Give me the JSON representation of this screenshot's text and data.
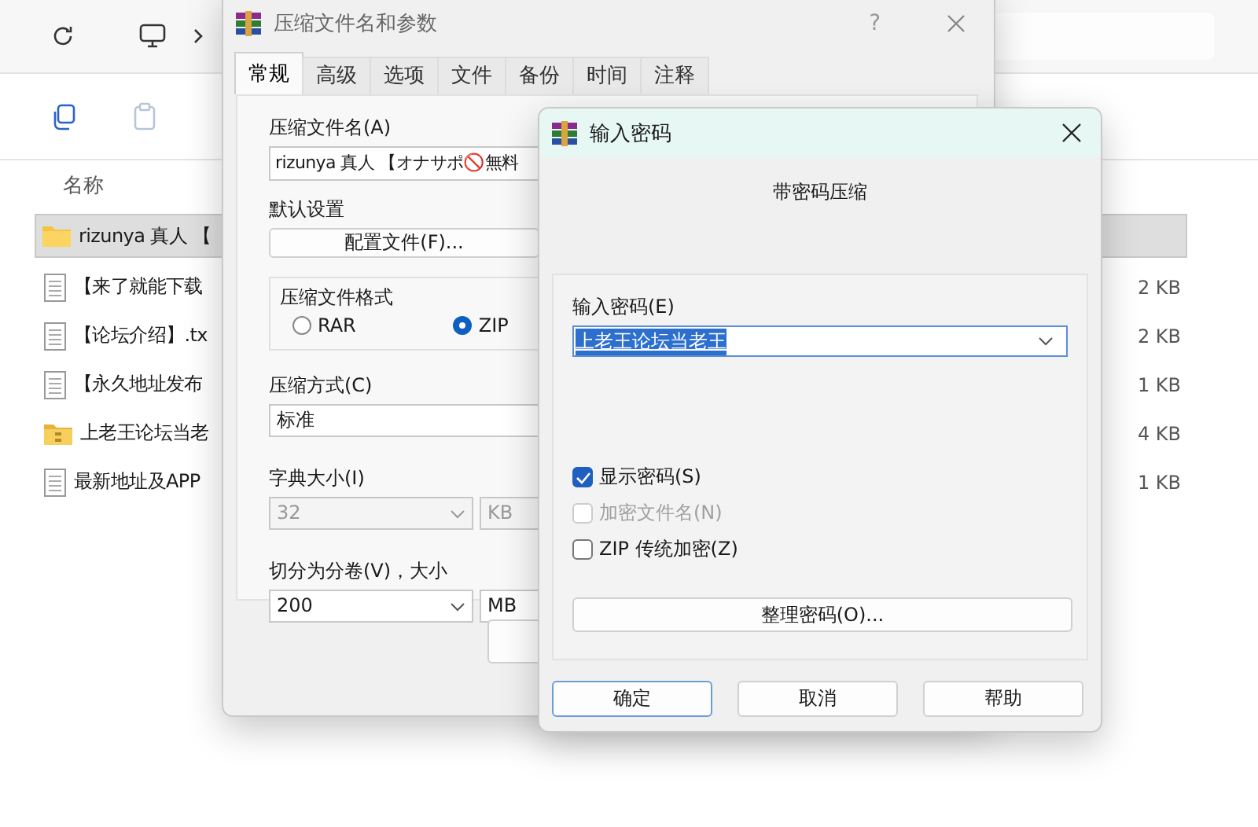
{
  "explorer": {
    "column_header": "名称",
    "files": [
      {
        "name": "rizunya 真人 【",
        "kind": "folder",
        "selected": true
      },
      {
        "name": "【来了就能下载",
        "kind": "text",
        "size": "2 KB",
        "selected": false
      },
      {
        "name": "【论坛介绍】.tx",
        "kind": "text",
        "size": "2 KB",
        "selected": false
      },
      {
        "name": "【永久地址发布",
        "kind": "text",
        "size": "1 KB",
        "selected": false
      },
      {
        "name": "上老王论坛当老",
        "kind": "archive",
        "size": "4 KB",
        "selected": false
      },
      {
        "name": "最新地址及APP",
        "kind": "text",
        "size": "1 KB",
        "selected": false
      }
    ]
  },
  "archive_dialog": {
    "title": "压缩文件名和参数",
    "help": "?",
    "tabs": [
      {
        "label": "常规",
        "selected": true
      },
      {
        "label": "高级",
        "selected": false
      },
      {
        "label": "选项",
        "selected": false
      },
      {
        "label": "文件",
        "selected": false
      },
      {
        "label": "备份",
        "selected": false
      },
      {
        "label": "时间",
        "selected": false
      },
      {
        "label": "注释",
        "selected": false
      }
    ],
    "archive_name_label": "压缩文件名(A)",
    "archive_name": "rizunya 真人 【オナサポ🚫無料",
    "defaults_label": "默认设置",
    "profile_button": "配置文件(F)...",
    "format": {
      "label": "压缩文件格式",
      "options": [
        {
          "label": "RAR",
          "selected": false
        },
        {
          "label": "ZIP",
          "selected": true
        }
      ]
    },
    "method_label": "压缩方式(C)",
    "method": "标准",
    "dictionary": {
      "label": "字典大小(I)",
      "value": "32",
      "unit": "KB",
      "disabled": true
    },
    "split": {
      "label": "切分为分卷(V)，大小",
      "value": "200",
      "unit": "MB",
      "disabled": false
    }
  },
  "password_dialog": {
    "title": "输入密码",
    "heading": "带密码压缩",
    "password_label": "输入密码(E)",
    "password": "上老王论坛当老王",
    "password_selected": true,
    "options": [
      {
        "label": "显示密码(S)",
        "checked": true,
        "disabled": false
      },
      {
        "label": "加密文件名(N)",
        "checked": false,
        "disabled": true
      },
      {
        "label": "ZIP 传统加密(Z)",
        "checked": false,
        "disabled": false
      }
    ],
    "organize_button": "整理密码(O)...",
    "buttons": [
      {
        "label": "确定",
        "default": true
      },
      {
        "label": "取消",
        "default": false
      },
      {
        "label": "帮助",
        "default": false
      }
    ]
  }
}
